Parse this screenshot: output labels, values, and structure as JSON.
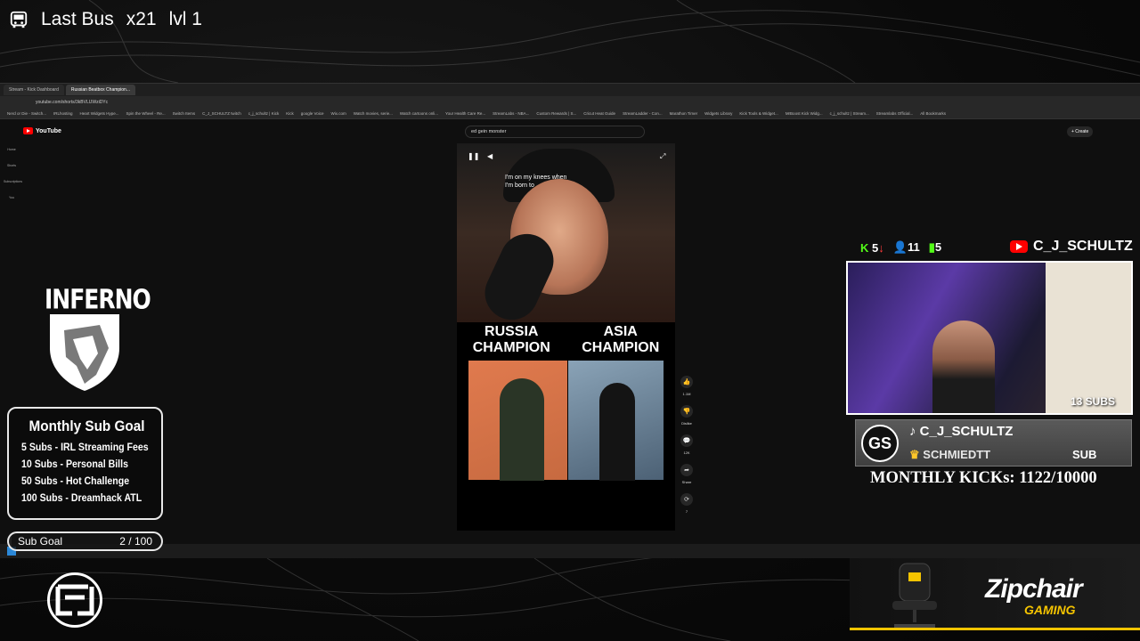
{
  "busbar": {
    "title": "Last Bus",
    "multiplier": "x21",
    "level": "lvl 1"
  },
  "browser": {
    "tabs": [
      {
        "label": "Stream - Kick Dashboard"
      },
      {
        "label": "Russian Beatbox Champion..."
      }
    ],
    "url": "youtube.com/shorts/3kBVLUWziDYc",
    "bookmarks": [
      "Nerd or Die - Switch...",
      "IRLhosting",
      "Heart Widgets Hype...",
      "Spin the Wheel - Re...",
      "Switch Items",
      "C_J_SCHULTZ twitch",
      "c_j_schultz | Kick",
      "Kick",
      "google Voice",
      "Wix.com",
      "Watch movies, serie...",
      "Watch cartoons onli...",
      "Your Health Care Re...",
      "StreamLabs - NBA...",
      "Custom Rewards | S...",
      "Cricut Heat Guide",
      "StreamLadder - Con...",
      "Marathon Timer",
      "Widgets Library",
      "Kick Tools & Widget...",
      "MrBoost Kick Widg...",
      "c_j_schultz | Stream...",
      "Streamlabs Official...",
      "All Bookmarks"
    ]
  },
  "youtube": {
    "logo": "YouTube",
    "search_value": "ed gein monster",
    "create_label": "+ Create",
    "side_items": [
      "Home",
      "Shorts",
      "Subscriptions",
      "You"
    ],
    "caption": "I'm on my knees when\nI'm born to",
    "champ_left": "RUSSIA\nCHAMPION",
    "champ_right": "ASIA\nCHAMPION",
    "likes": "1.1M",
    "dislike": "Dislike",
    "comments": "12K",
    "share": "Share",
    "remix": "7"
  },
  "overlay": {
    "inferno": "INFERNO",
    "goal_title": "Monthly Sub Goal",
    "goal_rows": [
      "5 Subs - IRL Streaming Fees",
      "10 Subs - Personal Bills",
      "50 Subs - Hot Challenge",
      "100 Subs - Dreamhack ATL"
    ],
    "subgoal_label": "Sub Goal",
    "subgoal_value": "2 / 100",
    "subgoal_progress": 0.02,
    "stat_kicks": "5",
    "stat_followers": "11",
    "stat_subs": "5",
    "channel_name": "C_J_SCHULTZ",
    "cam_subs": "13 SUBS",
    "tiktok_name": "C_J_SCHULTZ",
    "latest_sub_name": "SCHMIEDTT",
    "latest_sub_label": "SUB",
    "monthly_kicks": "MONTHLY KICKs: 1122/10000",
    "sponsor_brand": "Zipchair",
    "sponsor_sub": "GAMING"
  },
  "colors": {
    "kick_green": "#53fc18",
    "youtube_red": "#ff0000",
    "sponsor_yellow": "#f5c400"
  }
}
